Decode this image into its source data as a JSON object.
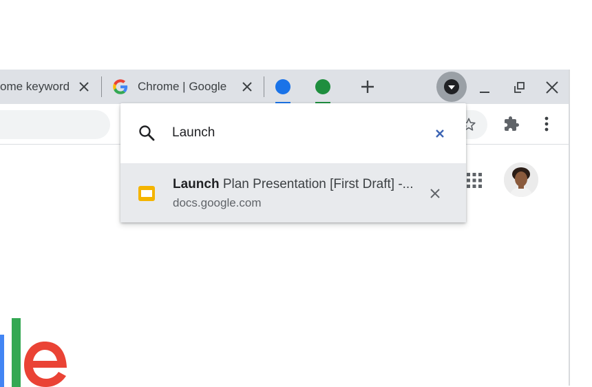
{
  "tabs": [
    {
      "title": "ome keyword",
      "close_glyph": "✕"
    },
    {
      "title": "Chrome | Google",
      "close_glyph": "✕",
      "favicon": "google-g-icon"
    }
  ],
  "tab_groups": [
    {
      "color": "#1a73e8"
    },
    {
      "color": "#1e8e3e"
    }
  ],
  "new_tab_glyph": "+",
  "window_controls": {
    "minimize": "—",
    "close": "✕"
  },
  "tab_search": {
    "query": "Launch",
    "clear_glyph": "✕",
    "result": {
      "title_match": "Launch",
      "title_rest": " Plan Presentation [First Draft] -...",
      "url": "docs.google.com",
      "close_glyph": "✕",
      "favicon": "google-slides-icon",
      "favicon_color": "#f4b400"
    }
  },
  "page_logo_visible": "le",
  "colors": {
    "tabstrip": "#dee1e6",
    "accent_blue": "#1a73e8",
    "clear_x_blue": "#3c64b4"
  }
}
